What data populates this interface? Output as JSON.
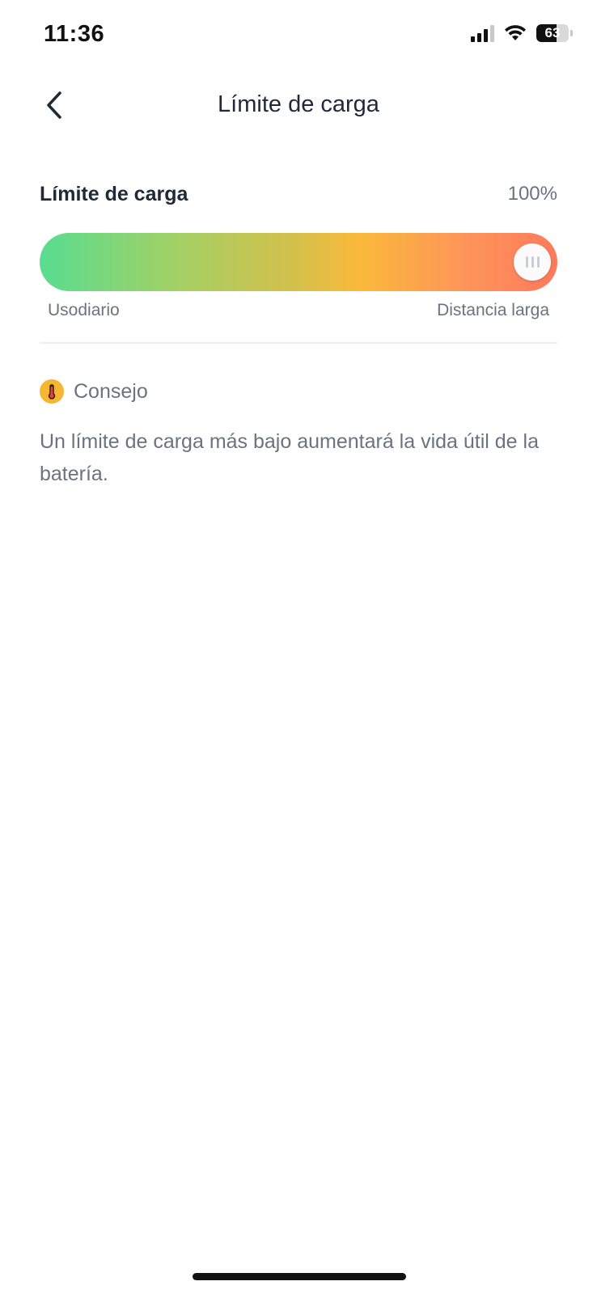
{
  "status_bar": {
    "time": "11:36",
    "battery_level": "63",
    "icons": [
      "signal-icon",
      "wifi-icon",
      "battery-icon"
    ]
  },
  "header": {
    "title": "Límite de carga",
    "back_icon": "chevron-left-icon"
  },
  "charge_limit": {
    "label": "Límite de carga",
    "value_text": "100%",
    "value_percent": 100,
    "scale_min_label": "Usodiario",
    "scale_max_label": "Distancia larga"
  },
  "tip": {
    "icon": "thermometer-icon",
    "title": "Consejo",
    "text": "Un límite de carga más bajo aumentará la vida útil de la batería."
  },
  "colors": {
    "gradient_start": "#58dd90",
    "gradient_mid": "#fbb83a",
    "gradient_end": "#fd7a5c",
    "tip_icon": "#f5b731"
  }
}
